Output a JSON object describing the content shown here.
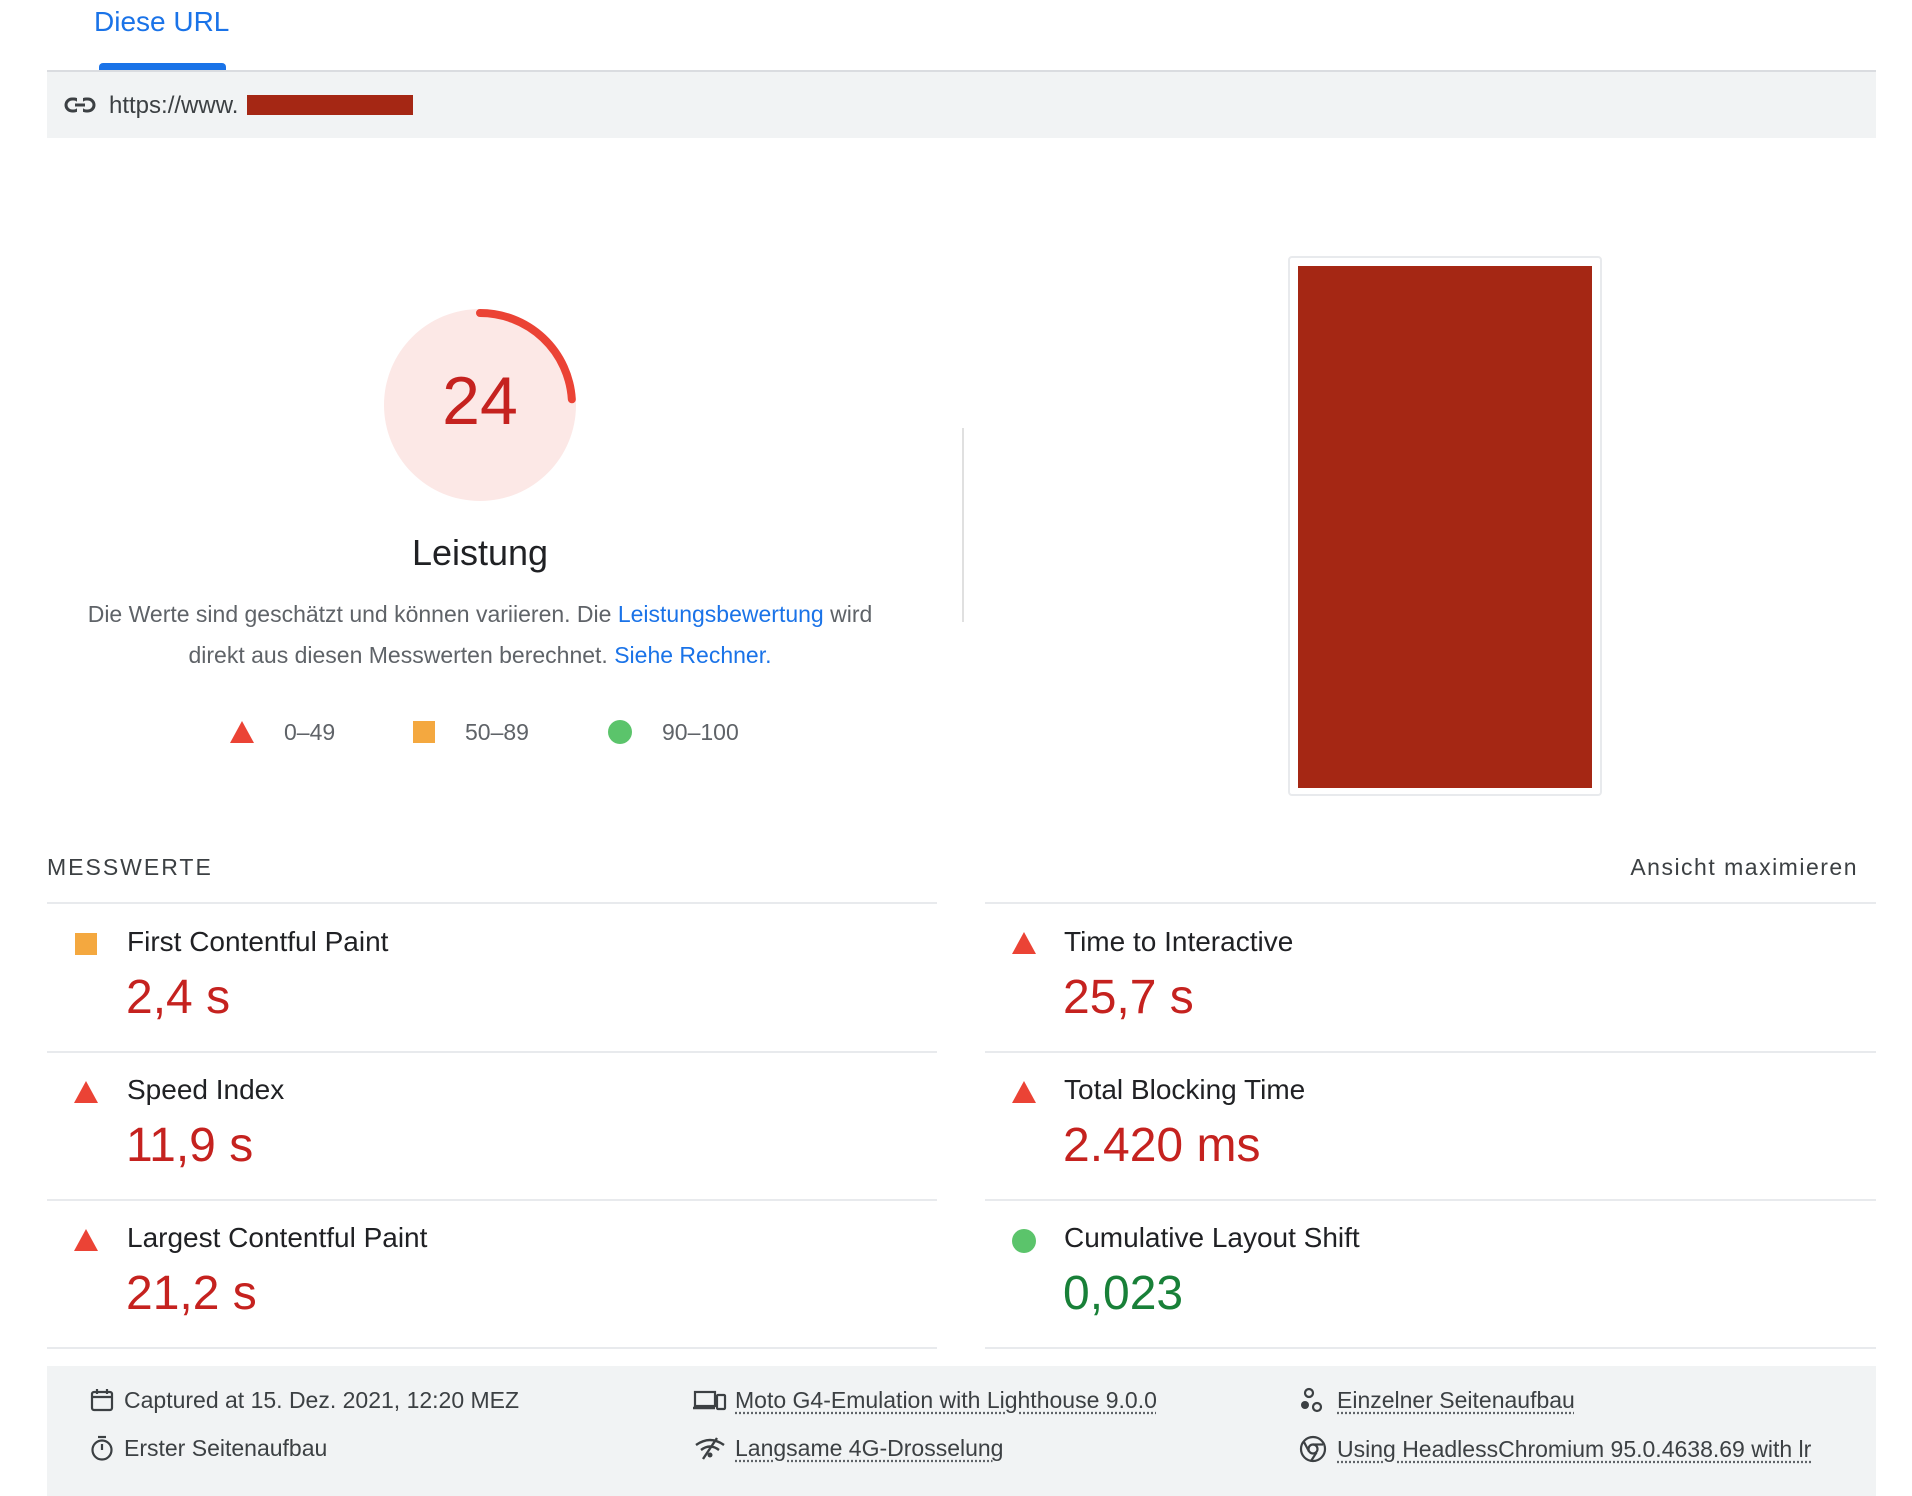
{
  "tab": {
    "label": "Diese URL"
  },
  "url_bar": {
    "url_prefix": "https://www.",
    "url_suffix": "/",
    "link_icon": "link-icon"
  },
  "score": {
    "value": "24",
    "fraction": 0.24,
    "title": "Leistung",
    "description_1": "Die Werte sind geschätzt und können variieren. Die ",
    "description_link_1": "Leistungsbewertung",
    "description_2": " wird direkt aus diesen Messwerten berechnet. ",
    "description_link_2": "Siehe Rechner.",
    "color": "#c5221f",
    "arc_color": "#eb4335",
    "bg_color": "#fce8e6"
  },
  "legend": [
    {
      "icon": "red-triangle-icon",
      "label": "0–49"
    },
    {
      "icon": "orange-square-icon",
      "label": "50–89"
    },
    {
      "icon": "green-circle-icon",
      "label": "90–100"
    }
  ],
  "metrics_section": {
    "title": "MESSWERTE",
    "expand_label": "Ansicht maximieren",
    "items": [
      {
        "name": "First Contentful Paint",
        "value": "2,4 s",
        "status": "average",
        "icon": "orange-square-icon"
      },
      {
        "name": "Time to Interactive",
        "value": "25,7 s",
        "status": "fail",
        "icon": "red-triangle-icon"
      },
      {
        "name": "Speed Index",
        "value": "11,9 s",
        "status": "fail",
        "icon": "red-triangle-icon"
      },
      {
        "name": "Total Blocking Time",
        "value": "2.420 ms",
        "status": "fail",
        "icon": "red-triangle-icon"
      },
      {
        "name": "Largest Contentful Paint",
        "value": "21,2 s",
        "status": "fail",
        "icon": "red-triangle-icon"
      },
      {
        "name": "Cumulative Layout Shift",
        "value": "0,023",
        "status": "pass",
        "icon": "green-circle-icon"
      }
    ]
  },
  "footer": {
    "captured": "Captured at 15. Dez. 2021, 12:20 MEZ",
    "first_load": "Erster Seitenaufbau",
    "device": "Moto G4-Emulation with Lighthouse 9.0.0",
    "throttling": "Langsame 4G-Drosselung",
    "single_load": "Einzelner Seitenaufbau",
    "browser": "Using HeadlessChromium 95.0.4638.69 with lr"
  },
  "colors": {
    "accent": "#1a73e8",
    "fail": "#c5221f",
    "pass": "#188038",
    "average_icon": "#f4a83f",
    "fail_icon": "#eb4335",
    "pass_icon": "#5bc46b",
    "redaction": "#a52714"
  }
}
